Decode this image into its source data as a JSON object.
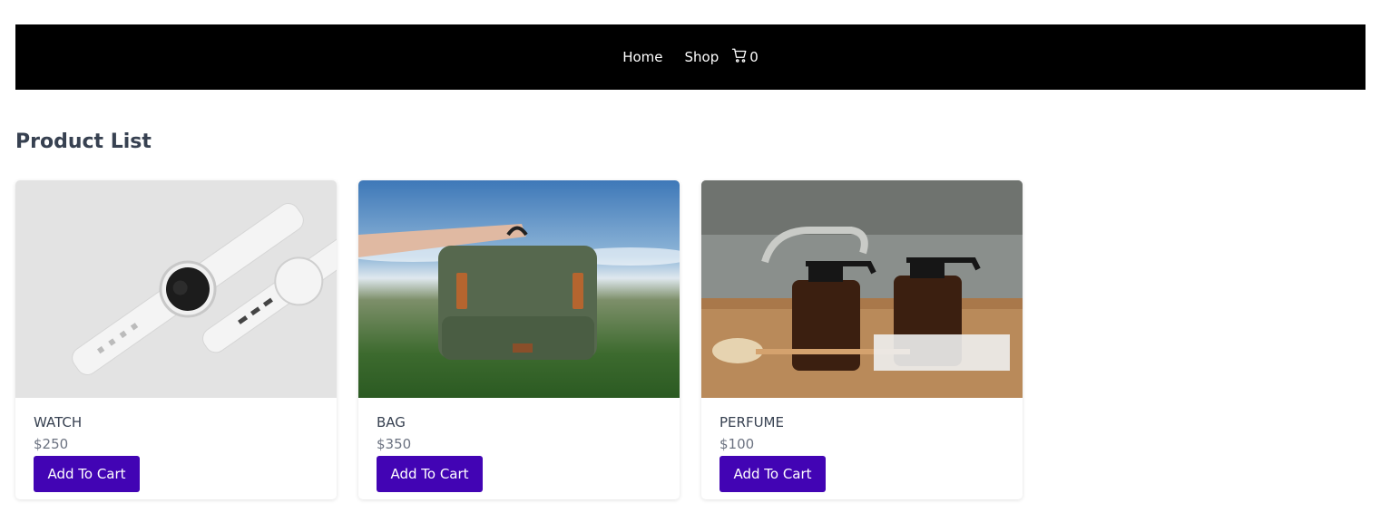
{
  "nav": {
    "links": [
      {
        "label": "Home"
      },
      {
        "label": "Shop"
      }
    ],
    "cart_count": "0"
  },
  "page": {
    "title": "Product List"
  },
  "products": [
    {
      "name": "WATCH",
      "price": "$250",
      "button_label": "Add To Cart",
      "image": "watch-photo"
    },
    {
      "name": "BAG",
      "price": "$350",
      "button_label": "Add To Cart",
      "image": "backpack-photo"
    },
    {
      "name": "PERFUME",
      "price": "$100",
      "button_label": "Add To Cart",
      "image": "amber-spray-bottles-photo"
    }
  ],
  "colors": {
    "navbar_bg": "#000000",
    "button_bg": "#4204b4",
    "title_text": "#374151",
    "price_text": "#6b7280"
  }
}
